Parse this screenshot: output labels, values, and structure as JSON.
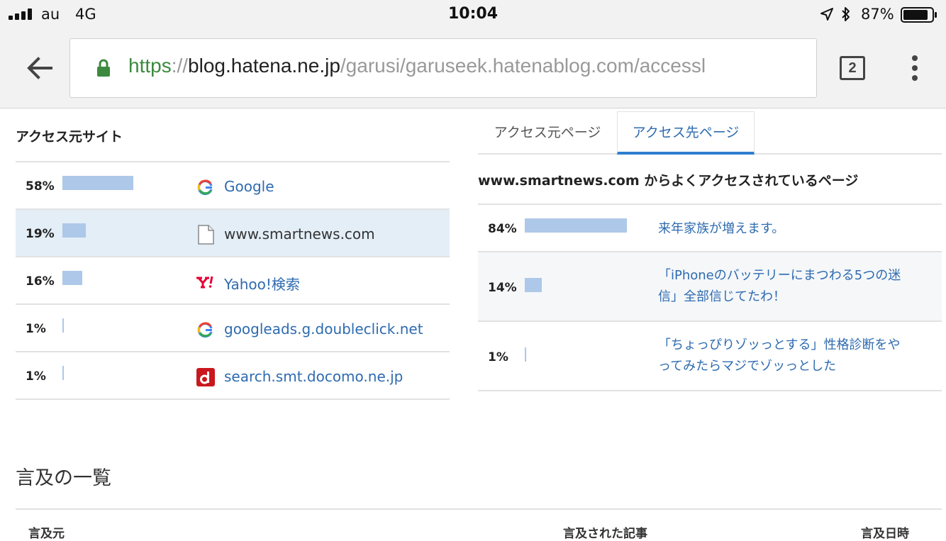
{
  "status_bar": {
    "carrier": "au",
    "network": "4G",
    "time": "10:04",
    "battery_percent": "87%",
    "battery_level": 0.87,
    "signal_bars": 4
  },
  "browser": {
    "url_scheme": "https",
    "url_separator": "://",
    "url_host": "blog.hatena.ne.jp",
    "url_path": "/garusi/garuseek.hatenablog.com/accessl",
    "tab_count": "2"
  },
  "access_sources": {
    "title": "アクセス元サイト",
    "rows": [
      {
        "percent": "58%",
        "value": 58,
        "icon": "google-icon",
        "name": "Google",
        "linked": true
      },
      {
        "percent": "19%",
        "value": 19,
        "icon": "page-icon",
        "name": "www.smartnews.com",
        "linked": false,
        "highlighted": true
      },
      {
        "percent": "16%",
        "value": 16,
        "icon": "yahoo-icon",
        "name": "Yahoo!検索",
        "linked": true
      },
      {
        "percent": "1%",
        "value": 1,
        "icon": "google-icon",
        "name": "googleads.g.doubleclick.net",
        "linked": true
      },
      {
        "percent": "1%",
        "value": 1,
        "icon": "docomo-icon",
        "name": "search.smt.docomo.ne.jp",
        "linked": true
      }
    ]
  },
  "page_tabs": {
    "tab_source": "アクセス元ページ",
    "tab_destination": "アクセス先ページ",
    "active": "tab_destination"
  },
  "destination_pages": {
    "title": "www.smartnews.com からよくアクセスされているページ",
    "rows": [
      {
        "percent": "84%",
        "value": 84,
        "line1": "来年家族が増えます。",
        "line2": ""
      },
      {
        "percent": "14%",
        "value": 14,
        "line1": "「iPhoneのバッテリーにまつわる5つの迷",
        "line2": "信」全部信じてたわ！"
      },
      {
        "percent": "1%",
        "value": 1,
        "line1": "「ちょっぴりゾッっとする」性格診断をや",
        "line2": "ってみたらマジでゾッっとした"
      }
    ]
  },
  "mentions": {
    "title": "言及の一覧",
    "col_source": "言及元",
    "col_article": "言及された記事",
    "col_date": "言及日時"
  },
  "colors": {
    "bar": "#adc8e8",
    "link": "#2e6bb0",
    "highlight_row": "#e3eef7",
    "active_tab_underline": "#2e7fd0",
    "secure_green": "#3c8a3f"
  }
}
